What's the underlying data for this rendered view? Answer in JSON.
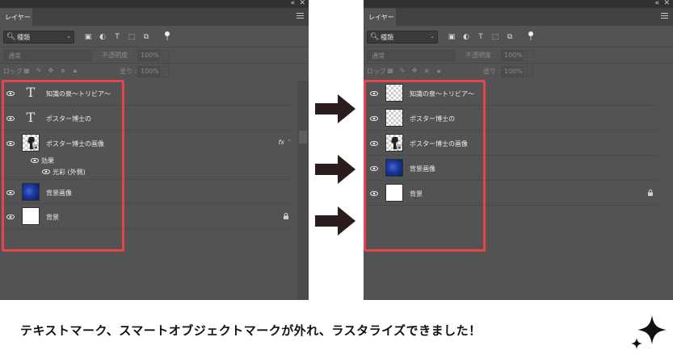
{
  "panels": [
    {
      "id": "before",
      "tab_label": "レイヤー",
      "filter_kind": "種類",
      "blend_mode": "通常",
      "opacity_label": "不透明度 :",
      "opacity_value": "100%",
      "lock_label": "ロック :",
      "fill_label": "塗り :",
      "fill_value": "100%",
      "layers": [
        {
          "name": "知識の泉〜トリビア〜",
          "thumb": "text-icon",
          "visible": true
        },
        {
          "name": "ポスター博士の",
          "thumb": "text-icon",
          "visible": true
        },
        {
          "name": "ポスター博士の画像",
          "thumb": "smart-object",
          "visible": true,
          "fx": "fx"
        },
        {
          "name": "背景画像",
          "thumb": "image",
          "visible": true
        },
        {
          "name": "背景",
          "thumb": "white",
          "visible": true,
          "locked": true
        }
      ],
      "effects_label": "効果",
      "outer_glow_label": "光彩 (外側)"
    },
    {
      "id": "after",
      "tab_label": "レイヤー",
      "filter_kind": "種類",
      "blend_mode": "通常",
      "opacity_label": "不透明度 :",
      "opacity_value": "100%",
      "lock_label": "ロック :",
      "fill_label": "塗り :",
      "fill_value": "100%",
      "layers": [
        {
          "name": "知識の泉〜トリビア〜",
          "thumb": "raster",
          "visible": true
        },
        {
          "name": "ポスター博士の",
          "thumb": "raster",
          "visible": true
        },
        {
          "name": "ポスター博士の画像",
          "thumb": "raster-poster",
          "visible": true
        },
        {
          "name": "背景画像",
          "thumb": "image",
          "visible": true
        },
        {
          "name": "背景",
          "thumb": "white",
          "visible": true,
          "locked": true
        }
      ]
    }
  ],
  "caption": "テキストマーク、スマートオブジェクトマークが外れ、ラスタライズできました！",
  "colors": {
    "highlight": "#e8424a",
    "arrow": "#2b1d1d",
    "panel_bg": "#535353"
  }
}
